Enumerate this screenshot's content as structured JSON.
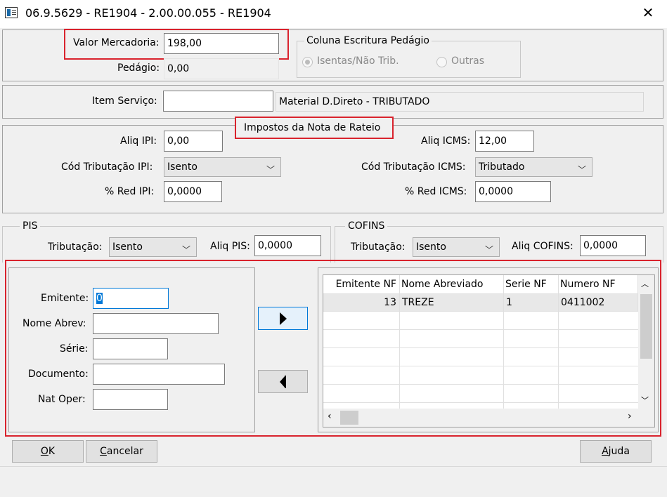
{
  "window": {
    "title": "06.9.5629 - RE1904 - 2.00.00.055 - RE1904"
  },
  "top": {
    "valor_mercadoria_label": "Valor Mercadoria:",
    "valor_mercadoria_value": "198,00",
    "pedagio_label": "Pedágio:",
    "pedagio_value": "0,00",
    "coluna_group_title": "Coluna Escritura Pedágio",
    "radio_isentas": "Isentas/Não Trib.",
    "radio_outras": "Outras"
  },
  "item": {
    "label": "Item Serviço:",
    "value": "",
    "description": "Material D.Direto - TRIBUTADO"
  },
  "impostos": {
    "title": "Impostos da Nota de Rateio",
    "aliq_ipi_label": "Aliq IPI:",
    "aliq_ipi_value": "0,00",
    "cod_trib_ipi_label": "Cód Tributação IPI:",
    "cod_trib_ipi_value": "Isento",
    "red_ipi_label": "% Red IPI:",
    "red_ipi_value": "0,0000",
    "aliq_icms_label": "Aliq ICMS:",
    "aliq_icms_value": "12,00",
    "cod_trib_icms_label": "Cód Tributação ICMS:",
    "cod_trib_icms_value": "Tributado",
    "red_icms_label": "% Red ICMS:",
    "red_icms_value": "0,0000"
  },
  "pis": {
    "title": "PIS",
    "trib_label": "Tributação:",
    "trib_value": "Isento",
    "aliq_label": "Aliq PIS:",
    "aliq_value": "0,0000"
  },
  "cofins": {
    "title": "COFINS",
    "trib_label": "Tributação:",
    "trib_value": "Isento",
    "aliq_label": "Aliq COFINS:",
    "aliq_value": "0,0000"
  },
  "filter": {
    "emitente_label": "Emitente:",
    "emitente_value": "0",
    "nome_abrev_label": "Nome Abrev:",
    "serie_label": "Série:",
    "documento_label": "Documento:",
    "nat_oper_label": "Nat Oper:"
  },
  "grid": {
    "columns": [
      "Emitente NF",
      "Nome Abreviado",
      "Serie NF",
      "Numero NF"
    ],
    "rows": [
      [
        "13",
        "TREZE",
        "1",
        "0411002"
      ]
    ]
  },
  "buttons": {
    "ok_prefix": "",
    "ok_underline": "O",
    "ok_rest": "K",
    "cancelar_underline": "C",
    "cancelar_rest": "ancelar",
    "ajuda_prefix": "",
    "ajuda_underline": "A",
    "ajuda_rest": "juda"
  },
  "colors": {
    "highlight_red": "#d9232d",
    "selected_text_bg": "#0078d7"
  }
}
